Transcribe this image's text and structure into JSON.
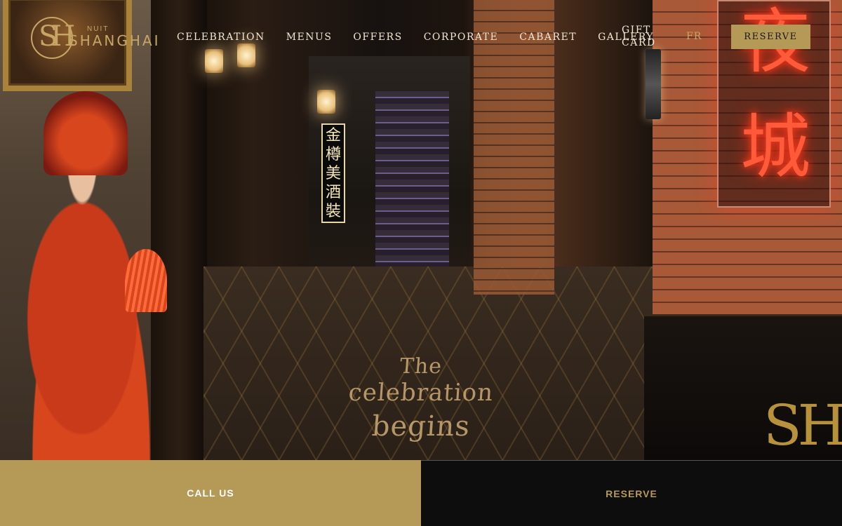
{
  "brand": {
    "small": "NUIT",
    "name": "SHANGHAI",
    "monogram": "SH"
  },
  "nav": {
    "items": [
      "CELEBRATION",
      "MENUS",
      "OFFERS",
      "CORPORATE",
      "CABARET",
      "GALLERY"
    ],
    "gift_card": "GIFT CARD",
    "lang": "FR",
    "reserve": "RESERVE"
  },
  "hero": {
    "tagline_line1": "The",
    "tagline_line2": "celebration",
    "tagline_line3": "begins",
    "sign_vertical": "金樽美酒裝",
    "neon_char_1": "夜",
    "neon_char_2": "城",
    "counter_monogram": "SH"
  },
  "actions": {
    "call": "CALL US",
    "reserve": "RESERVE"
  },
  "colors": {
    "gold": "#b59a57",
    "dark": "#0d0d0d",
    "nav_text": "#f1e7d2",
    "neon": "#ff5a3a"
  }
}
